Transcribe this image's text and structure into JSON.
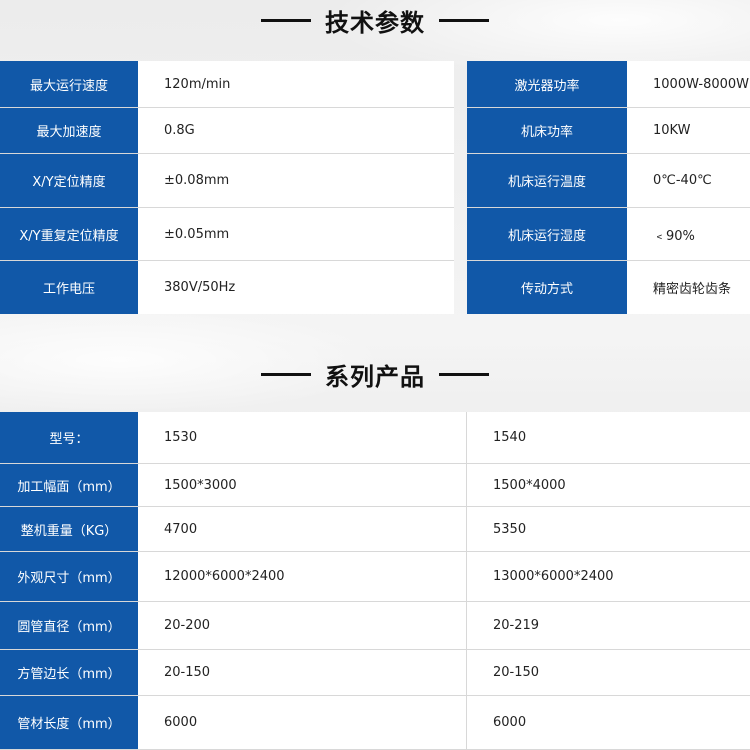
{
  "tech_params": {
    "title": "技术参数",
    "left": [
      {
        "label": "最大运行速度",
        "value": "120m/min"
      },
      {
        "label": "最大加速度",
        "value": "0.8G"
      },
      {
        "label": "X/Y定位精度",
        "value": "±0.08mm"
      },
      {
        "label": "X/Y重复定位精度",
        "value": "±0.05mm"
      },
      {
        "label": "工作电压",
        "value": "380V/50Hz"
      }
    ],
    "right": [
      {
        "label": "激光器功率",
        "value": "1000W-8000W"
      },
      {
        "label": "机床功率",
        "value": "10KW"
      },
      {
        "label": "机床运行温度",
        "value": "0℃-40℃"
      },
      {
        "label": "机床运行湿度",
        "value": "﹤90%"
      },
      {
        "label": "传动方式",
        "value": "精密齿轮齿条"
      }
    ]
  },
  "series": {
    "title": "系列产品",
    "rows": [
      {
        "label": "型号：",
        "a": "1530",
        "b": "1540"
      },
      {
        "label": "加工幅面（mm）",
        "a": "1500*3000",
        "b": "1500*4000"
      },
      {
        "label": "整机重量（KG）",
        "a": "4700",
        "b": "5350"
      },
      {
        "label": "外观尺寸（mm）",
        "a": "12000*6000*2400",
        "b": "13000*6000*2400"
      },
      {
        "label": "圆管直径（mm）",
        "a": "20-200",
        "b": "20-219"
      },
      {
        "label": "方管边长（mm）",
        "a": "20-150",
        "b": "20-150"
      },
      {
        "label": "管材长度（mm）",
        "a": "6000",
        "b": "6000"
      }
    ]
  },
  "colors": {
    "label_bg": "#1158a8",
    "label_text": "#ffffff"
  }
}
